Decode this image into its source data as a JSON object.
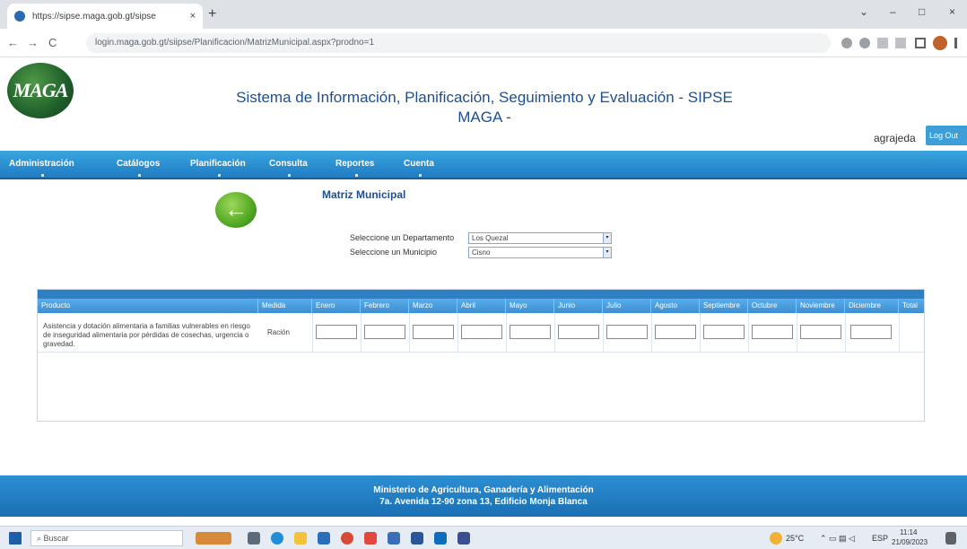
{
  "browser": {
    "tab_title": "https://sipse.maga.gob.gt/sipse",
    "tab_close": "×",
    "new_tab": "+",
    "url": "login.maga.gob.gt/siipse/Planificacion/MatrizMunicipal.aspx?prodno=1",
    "back": "←",
    "forward": "→",
    "reload": "C",
    "minimize": "–",
    "maximize": "□",
    "close": "×",
    "dropdown": "⌄"
  },
  "header": {
    "logo_text": "MAGA",
    "title_line1": "Sistema de Información, Planificación, Seguimiento y Evaluación - SIPSE",
    "title_line2": "MAGA -",
    "user": "agrajeda",
    "logout": "Log Out"
  },
  "menu": [
    "Administración",
    "Catálogos",
    "Planificación",
    "Consulta",
    "Reportes",
    "Cuenta"
  ],
  "content": {
    "back_arrow": "←",
    "page_title": "Matriz Municipal",
    "departamento_label": "Seleccione un Departamento",
    "departamento_value": "Los Quezal",
    "municipio_label": "Seleccione un Municipio",
    "municipio_value": "Cisno",
    "dropdown_arrow": "▾"
  },
  "table": {
    "columns": [
      "Producto",
      "Medida",
      "Enero",
      "Febrero",
      "Marzo",
      "Abril",
      "Mayo",
      "Junio",
      "Julio",
      "Agosto",
      "Septiembre",
      "Octubre",
      "Noviembre",
      "Diciembre",
      "Total"
    ],
    "row": {
      "product": "Asistencia y dotación alimentaria a familias vulnerables en riesgo de inseguridad alimentaria por pérdidas de cosechas, urgencia o gravedad.",
      "unit": "Ración"
    }
  },
  "footer": {
    "line1": "Ministerio de Agricultura, Ganadería y Alimentación",
    "line2": "7a. Avenida 12-90 zona 13, Edificio Monja Blanca"
  },
  "taskbar": {
    "search": "Buscar",
    "weather": "25°C",
    "lang": "ESP",
    "time": "11:14",
    "date": "21/09/2023"
  }
}
